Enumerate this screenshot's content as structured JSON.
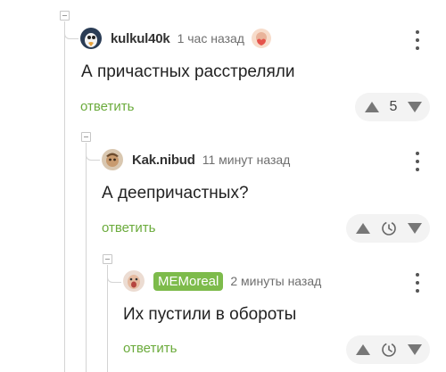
{
  "comments": [
    {
      "nick": "kulkul40k",
      "time": "1 час назад",
      "text": "А причастных расстреляли",
      "reply": "ответить",
      "rating": "5"
    },
    {
      "nick": "Kak.nibud",
      "time": "11 минут назад",
      "text": "А деепричастных?",
      "reply": "ответить"
    },
    {
      "nick": "MEMoreal",
      "time": "2 минуты назад",
      "text": "Их пустили в обороты",
      "reply": "ответить"
    }
  ],
  "colors": {
    "accent_green": "#6bab3c",
    "badge_green": "#7dbb4b",
    "vote_bg": "#f3f3f3"
  },
  "icons": [
    "collapse-icon",
    "more-icon",
    "upvote-icon",
    "downvote-icon",
    "clock-icon"
  ]
}
